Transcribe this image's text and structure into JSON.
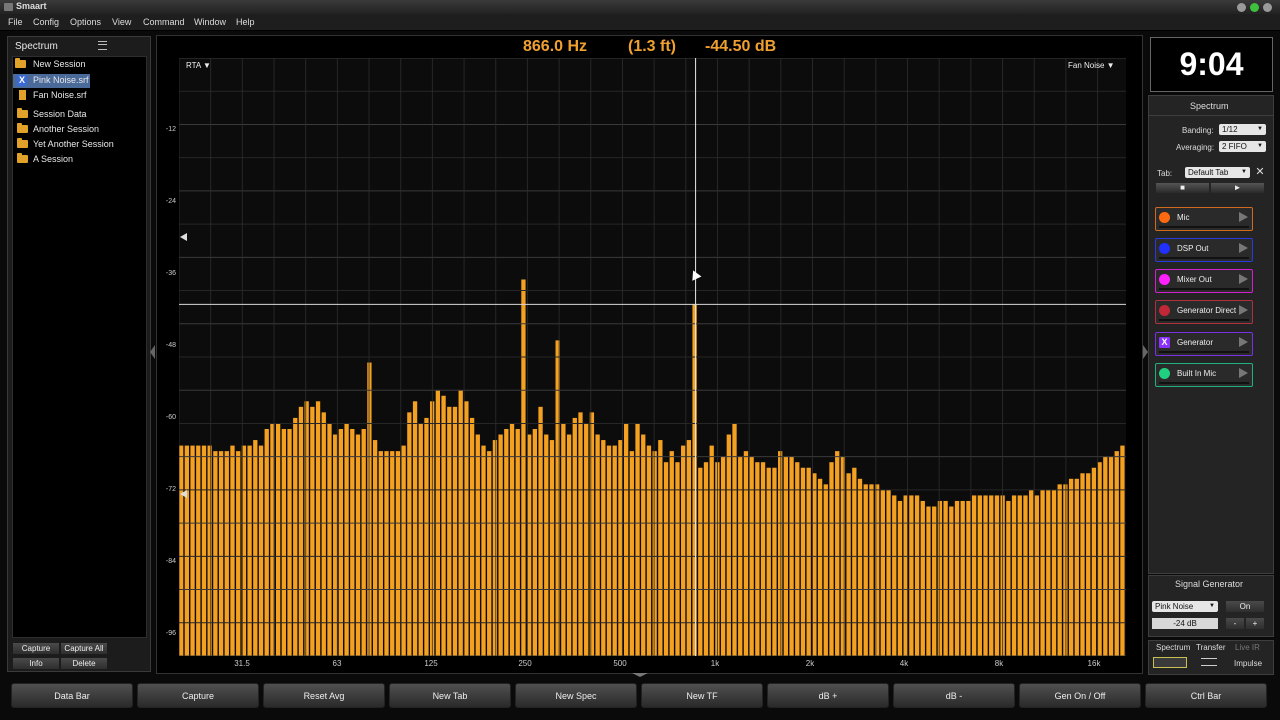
{
  "window": {
    "title": "Smaart"
  },
  "menu": [
    "File",
    "Config",
    "Options",
    "View",
    "Command",
    "Window",
    "Help"
  ],
  "left_panel": {
    "title": "Spectrum",
    "items": [
      {
        "label": "New Session",
        "icon": "folder-icon",
        "kind": "folder"
      },
      {
        "label": "Pink Noise.srf",
        "icon": "close-icon",
        "kind": "file-selected"
      },
      {
        "label": "Fan Noise.srf",
        "icon": "file-icon",
        "kind": "file"
      },
      {
        "label": "Session Data",
        "icon": "folder-icon",
        "kind": "folder"
      },
      {
        "label": "Another Session",
        "icon": "folder-icon",
        "kind": "folder"
      },
      {
        "label": "Yet Another Session",
        "icon": "folder-icon",
        "kind": "folder"
      },
      {
        "label": "A Session",
        "icon": "folder-icon",
        "kind": "folder"
      }
    ],
    "buttons": {
      "capture": "Capture",
      "capture_all": "Capture All",
      "info": "Info",
      "delete": "Delete"
    }
  },
  "readout": {
    "freq": "866.0 Hz",
    "dist": "(1.3 ft)",
    "level": "-44.50 dB"
  },
  "plot": {
    "mode_label": "RTA ▼",
    "trace_label": "Fan Noise ▼",
    "y_ticks": [
      "-12",
      "-24",
      "-36",
      "-48",
      "-60",
      "-72",
      "-84",
      "-96"
    ],
    "x_ticks": [
      "31.5",
      "63",
      "125",
      "250",
      "500",
      "1k",
      "2k",
      "4k",
      "8k",
      "16k"
    ],
    "cursor_level_db": -44.5,
    "cursor_freq_hz": 866.0,
    "bar_color": "#f4a020"
  },
  "chart_data": {
    "type": "bar",
    "title": "",
    "xlabel": "",
    "ylabel": "",
    "ylim": [
      -108,
      0
    ],
    "x_scale": "log",
    "x_range_hz": [
      20,
      20000
    ],
    "levels_db": [
      -70,
      -70,
      -70,
      -70,
      -70,
      -70,
      -71,
      -71,
      -71,
      -70,
      -71,
      -70,
      -70,
      -69,
      -70,
      -67,
      -66,
      -66,
      -67,
      -67,
      -65,
      -63,
      -62,
      -63,
      -62,
      -64,
      -66,
      -68,
      -67,
      -66,
      -67,
      -68,
      -67,
      -69,
      -69,
      -71,
      -71,
      -71,
      -71,
      -70,
      -64,
      -62,
      -66,
      -65,
      -62,
      -60,
      -61,
      -63,
      -63,
      -60,
      -62,
      -65,
      -68,
      -70,
      -71,
      -69,
      -68,
      -67,
      -66,
      -67,
      -65,
      -68,
      -67,
      -63,
      -68,
      -69,
      -51,
      -66,
      -68,
      -65,
      -64,
      -66,
      -64,
      -68,
      -69,
      -70,
      -70,
      -69,
      -66,
      -71,
      -66,
      -68,
      -70,
      -71,
      -69,
      -73,
      -71,
      -73,
      -70,
      -69,
      -66,
      -74,
      -73,
      -70,
      -73,
      -72,
      -68,
      -66,
      -72,
      -71,
      -72,
      -73,
      -73,
      -74,
      -74,
      -71,
      -72,
      -72,
      -73,
      -74,
      -74,
      -75,
      -76,
      -77,
      -73,
      -71,
      -72,
      -75,
      -74,
      -76,
      -77,
      -77,
      -77,
      -78,
      -78,
      -79,
      -80,
      -79,
      -79,
      -79,
      -80,
      -81,
      -81,
      -80,
      -80,
      -81,
      -80,
      -80,
      -80,
      -79,
      -79,
      -79,
      -79,
      -79,
      -79,
      -80,
      -79,
      -79,
      -79,
      -78,
      -79,
      -78,
      -78,
      -78,
      -77,
      -77,
      -76,
      -76,
      -75,
      -75,
      -74,
      -73,
      -72,
      -72,
      -71,
      -70
    ],
    "peaks": [
      {
        "freq_hz": 250,
        "level_db": -40
      },
      {
        "freq_hz": 866,
        "level_db": -44.5
      },
      {
        "freq_hz": 315,
        "level_db": -52
      },
      {
        "freq_hz": 80,
        "level_db": -55
      }
    ]
  },
  "clock": "9:04",
  "right_panel": {
    "title": "Spectrum",
    "banding_label": "Banding:",
    "banding_value": "1/12",
    "averaging_label": "Averaging:",
    "averaging_value": "2 FIFO",
    "tab_label": "Tab:",
    "tab_value": "Default Tab",
    "stop_symbol": "■",
    "play_symbol": "►",
    "channels": [
      {
        "name": "Mic",
        "color": "#ff6a10",
        "border": "#d06a20",
        "mark": ""
      },
      {
        "name": "DSP Out",
        "color": "#2030ff",
        "border": "#2a3adc",
        "mark": ""
      },
      {
        "name": "Mixer Out",
        "color": "#ff20ff",
        "border": "#d020d0",
        "mark": ""
      },
      {
        "name": "Generator Direct",
        "color": "#c02838",
        "border": "#b03040",
        "mark": ""
      },
      {
        "name": "Generator",
        "color": "#8a30ff",
        "border": "#7a30e0",
        "mark": "X"
      },
      {
        "name": "Built In Mic",
        "color": "#20d080",
        "border": "#20b080",
        "mark": ""
      }
    ]
  },
  "signal_generator": {
    "title": "Signal Generator",
    "type": "Pink Noise",
    "on_label": "On",
    "level": "-24 dB",
    "minus": "-",
    "plus": "+"
  },
  "view_tabs": {
    "spectrum": "Spectrum",
    "transfer": "Transfer",
    "live_ir": "Live IR",
    "impulse": "Impulse"
  },
  "toolbar": [
    "Data Bar",
    "Capture",
    "Reset Avg",
    "New Tab",
    "New Spec",
    "New TF",
    "dB +",
    "dB -",
    "Gen On / Off",
    "Ctrl Bar"
  ]
}
